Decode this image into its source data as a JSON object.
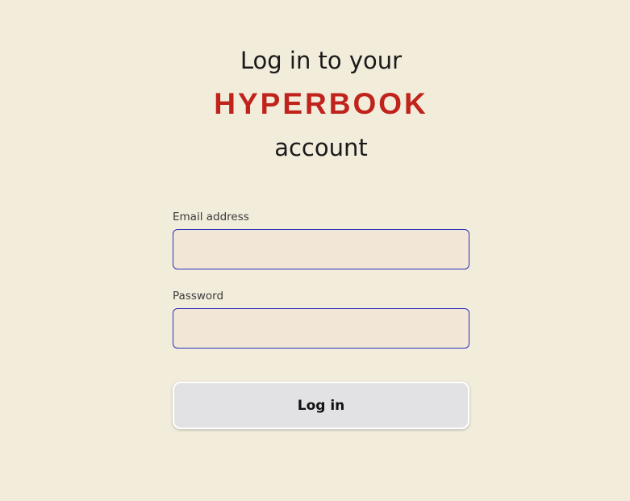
{
  "heading": {
    "line1": "Log in to your",
    "brand": "HYPERBOOK",
    "line3": "account"
  },
  "form": {
    "email": {
      "label": "Email address",
      "value": "",
      "placeholder": ""
    },
    "password": {
      "label": "Password",
      "value": "",
      "placeholder": ""
    },
    "submit_label": "Log in"
  },
  "colors": {
    "background": "#f2ecdb",
    "brand": "#c0231c",
    "input_border": "#2c32b8",
    "input_fill": "#f2e6d6",
    "button_fill": "#e2e2e4"
  }
}
